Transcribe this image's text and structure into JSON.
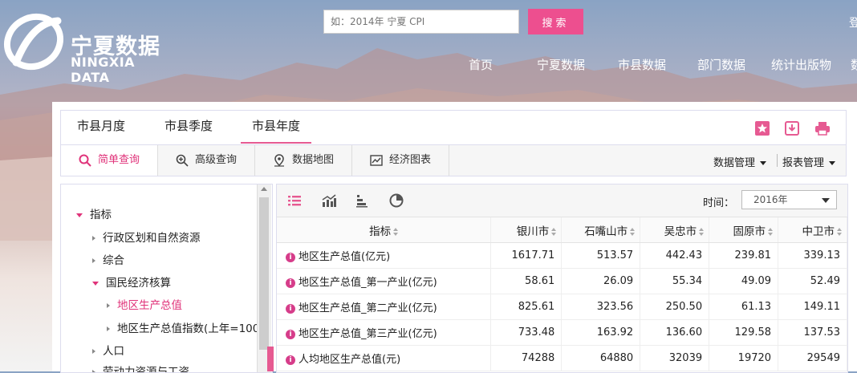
{
  "header": {
    "logo_cn": "宁夏数据",
    "logo_en": "NINGXIA DATA",
    "search_placeholder": "如：2014年 宁夏 CPI",
    "search_button": "搜索",
    "login": "登",
    "nav": [
      "首页",
      "宁夏数据",
      "市县数据",
      "部门数据",
      "统计出版物",
      "数"
    ]
  },
  "tabs": [
    "市县月度",
    "市县季度",
    "市县年度"
  ],
  "tab_icons": [
    "star-icon",
    "download-icon",
    "print-icon"
  ],
  "toolbar": {
    "tools": [
      "简单查询",
      "高级查询",
      "数据地图",
      "经济图表"
    ],
    "data_mgmt": "数据管理",
    "report_mgmt": "报表管理"
  },
  "tree": {
    "root": "指标",
    "items": [
      "行政区划和自然资源",
      "综合",
      "国民经济核算",
      "地区生产总值",
      "地区生产总值指数(上年=100",
      "人口",
      "劳动力资源与工资"
    ]
  },
  "data_panel": {
    "view_icons": [
      "list-icon",
      "line-chart-icon",
      "bar-chart-icon",
      "pie-chart-icon"
    ],
    "time_label": "时间：",
    "time_value": "2016年",
    "columns": [
      "指标",
      "银川市",
      "石嘴山市",
      "吴忠市",
      "固原市",
      "中卫市"
    ],
    "rows": [
      {
        "name": "地区生产总值(亿元)",
        "values": [
          "1617.71",
          "513.57",
          "442.43",
          "239.81",
          "339.13"
        ]
      },
      {
        "name": "地区生产总值_第一产业(亿元)",
        "values": [
          "58.61",
          "26.09",
          "55.34",
          "49.09",
          "52.49"
        ]
      },
      {
        "name": "地区生产总值_第二产业(亿元)",
        "values": [
          "825.61",
          "323.56",
          "250.50",
          "61.13",
          "149.11"
        ]
      },
      {
        "name": "地区生产总值_第三产业(亿元)",
        "values": [
          "733.48",
          "163.92",
          "136.60",
          "129.58",
          "137.53"
        ]
      },
      {
        "name": "人均地区生产总值(元)",
        "values": [
          "74288",
          "64880",
          "32039",
          "19720",
          "29549"
        ]
      }
    ]
  },
  "colors": {
    "accent": "#e0337a",
    "search_button": "#ed4f8f"
  }
}
